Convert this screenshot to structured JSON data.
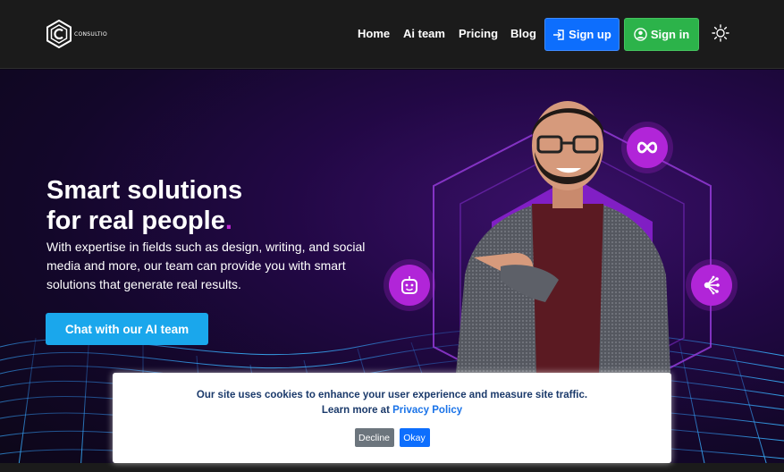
{
  "brand": {
    "logo_text": "CONSULTIO"
  },
  "nav": {
    "links": [
      "Home",
      "Ai team",
      "Pricing",
      "Blog"
    ],
    "signup_label": "Sign up",
    "signin_label": "Sign in"
  },
  "hero": {
    "title_line1": "Smart solutions",
    "title_line2": "for real people",
    "title_dot": ".",
    "description": "With expertise in fields such as design, writing, and social media and more, our team can provide you with smart solutions that generate real results.",
    "cta_label": "Chat with our AI team"
  },
  "cookie": {
    "message": "Our site uses cookies to enhance your user experience and measure site traffic.",
    "learn_more_prefix": "Learn more at",
    "policy_link": "Privacy Policy",
    "decline_label": "Decline",
    "okay_label": "Okay"
  },
  "colors": {
    "navbar_bg": "#1b1b1b",
    "signup_bg": "#0d6efd",
    "signin_bg": "#2cb34a",
    "cta_bg": "#1aa7ec",
    "accent_purple": "#b125d8",
    "title_dot": "#c026d3"
  },
  "icons": {
    "signup": "sign-in-arrow-icon",
    "signin": "user-circle-icon",
    "theme": "sun-icon",
    "feature_top": "infinity-icon",
    "feature_left": "robot-icon",
    "feature_right": "network-icon"
  }
}
